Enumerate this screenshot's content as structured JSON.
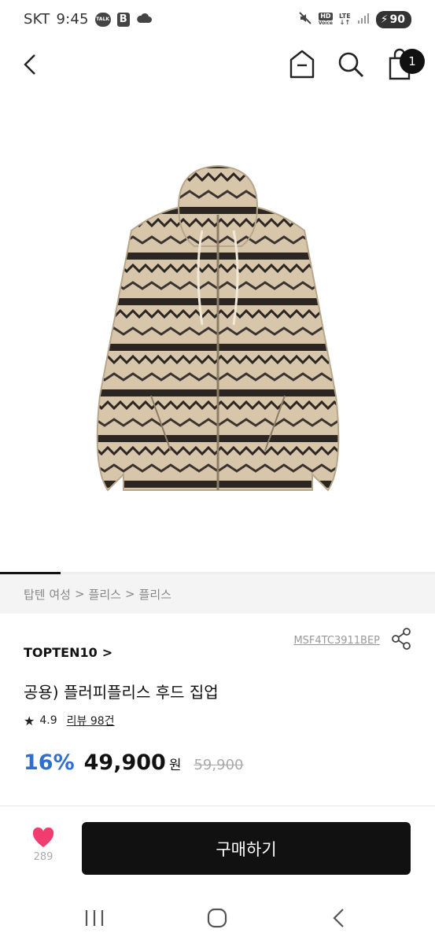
{
  "status_bar": {
    "carrier": "SKT",
    "time": "9:45",
    "talk_badge": "TALK",
    "b_badge": "B",
    "hd_label": "HD",
    "voice_label": "Voice",
    "lte_label": "LTE",
    "battery": "90"
  },
  "nav": {
    "cart_count": "1"
  },
  "product": {
    "breadcrumb": [
      "탑텐 여성",
      ">",
      "플리스",
      ">",
      "플리스"
    ],
    "sku": "MSF4TC3911BEP",
    "brand": "TOPTEN10",
    "brand_chevron": ">",
    "title": "공용) 플러피플리스 후드 집업",
    "rating": "4.9",
    "reviews": "리뷰 98건",
    "discount": "16%",
    "price": "49,900",
    "currency": "원",
    "original_price": "59,900"
  },
  "bottom": {
    "like_count": "289",
    "buy_label": "구매하기"
  },
  "image_indicator_fraction": 0.14,
  "colors": {
    "accent_blue": "#2f6fd0",
    "heart": "#f03c6e",
    "button_bg": "#111111"
  },
  "icons": [
    "back-icon",
    "home-icon",
    "search-icon",
    "shopping-bag-icon",
    "share-icon",
    "star-icon",
    "heart-icon",
    "recent-apps-icon",
    "system-home-icon",
    "system-back-icon"
  ]
}
